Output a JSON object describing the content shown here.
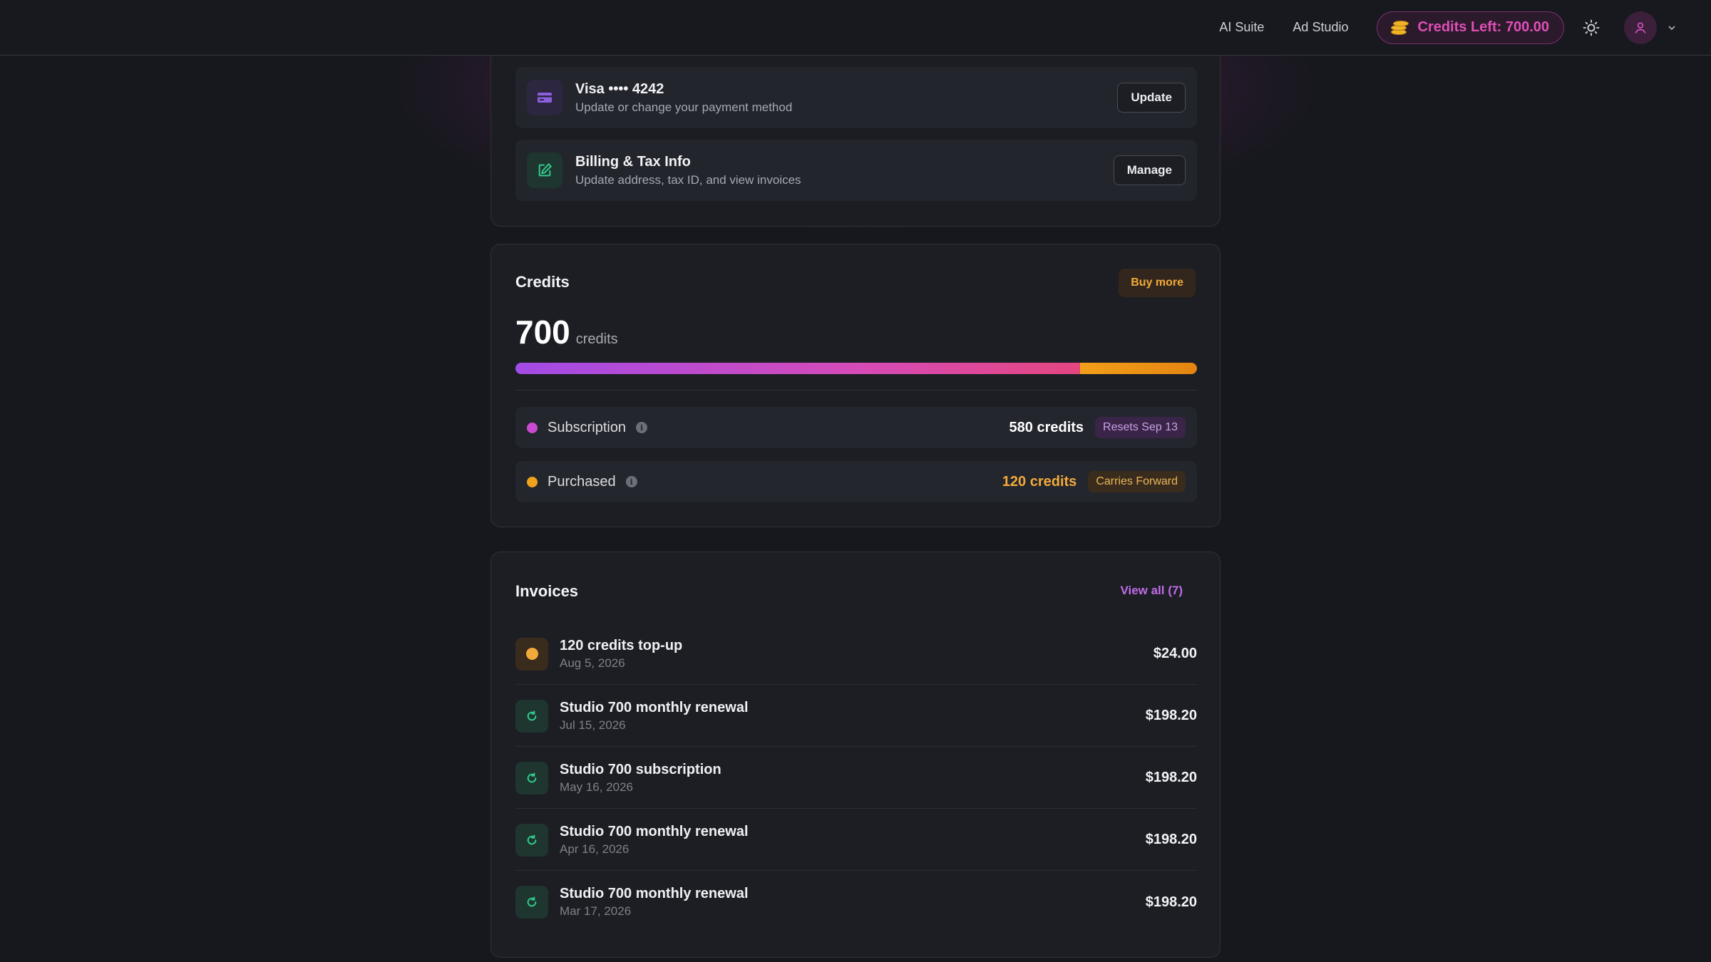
{
  "topbar": {
    "nav": [
      "AI Suite",
      "Ad Studio"
    ],
    "credits_label": "Credits Left: 700.00",
    "icons": {
      "coins": "coins-icon",
      "theme": "sun-icon",
      "avatar": "user-icon",
      "menu": "chevron-down-icon"
    }
  },
  "payment": {
    "card_title": "Visa •••• 4242",
    "card_subtitle": "Update or change your payment method",
    "card_button": "Update",
    "billing_title": "Billing & Tax Info",
    "billing_subtitle": "Update address, tax ID, and view invoices",
    "billing_button": "Manage"
  },
  "credits": {
    "title": "Credits",
    "buy_button": "Buy more",
    "total": "700",
    "unit": "credits",
    "subscription_share": 0.8286,
    "purchased_share": 0.1714,
    "rows": [
      {
        "label": "Subscription",
        "amount": "580 credits",
        "badge": "Resets Sep 13",
        "dot_color": "#c94bd0",
        "amount_color": "#ffffff"
      },
      {
        "label": "Purchased",
        "amount": "120 credits",
        "badge": "Carries Forward",
        "dot_color": "#f0a11e",
        "amount_color": "#f2a93b"
      }
    ]
  },
  "invoices": {
    "title": "Invoices",
    "view_all": "View all (7)",
    "items": [
      {
        "title": "120 credits top-up",
        "date": "Aug 5, 2026",
        "amount": "$24.00",
        "kind": "topup"
      },
      {
        "title": "Studio 700 monthly renewal",
        "date": "Jul 15, 2026",
        "amount": "$198.20",
        "kind": "renewal"
      },
      {
        "title": "Studio 700 subscription",
        "date": "May 16, 2026",
        "amount": "$198.20",
        "kind": "renewal"
      },
      {
        "title": "Studio 700 monthly renewal",
        "date": "Apr 16, 2026",
        "amount": "$198.20",
        "kind": "renewal"
      },
      {
        "title": "Studio 700 monthly renewal",
        "date": "Mar 17, 2026",
        "amount": "$198.20",
        "kind": "renewal"
      }
    ]
  },
  "colors": {
    "accent": "#c94bd0",
    "orange": "#f0a11e",
    "green": "#2fc48a",
    "bg": "#16181d"
  }
}
